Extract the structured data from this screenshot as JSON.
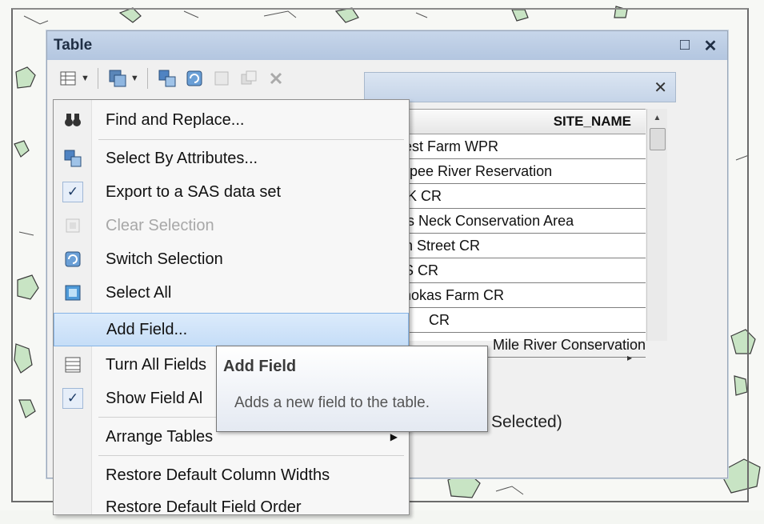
{
  "window": {
    "title": "Table"
  },
  "title_controls": {
    "restore": "□",
    "close": "✕"
  },
  "tab": {
    "close": "✕"
  },
  "table": {
    "column_header": "SITE_NAME",
    "rows": [
      "Hycrest Farm WPR",
      "Mashpee River Reservation",
      "COOK CR",
      "Wings Neck Conservation Area",
      "Heath Street CR",
      "HAAS CR",
      "Stelmokas Farm CR",
      "CR",
      "Mile River Conservation A"
    ]
  },
  "status": {
    "text": "Selected)"
  },
  "context_menu": {
    "items": [
      {
        "label": "Find and Replace...",
        "icon": "binoculars-icon"
      },
      {
        "label": "Select By Attributes...",
        "icon": "select-by-attributes-icon"
      },
      {
        "label": "Export to a SAS data set",
        "icon": "checkmark-icon"
      },
      {
        "label": "Clear Selection",
        "icon": "clear-selection-icon"
      },
      {
        "label": "Switch Selection",
        "icon": "switch-selection-icon"
      },
      {
        "label": "Select All",
        "icon": "select-all-icon"
      },
      {
        "label": "Add Field...",
        "icon": ""
      },
      {
        "label": "Turn All Fields",
        "icon": "field-list-icon"
      },
      {
        "label": "Show Field Al",
        "icon": "checkmark-icon"
      },
      {
        "label": "Arrange Tables",
        "icon": ""
      },
      {
        "label": "Restore Default Column Widths",
        "icon": ""
      },
      {
        "label": "Restore Default Field Order",
        "icon": ""
      }
    ],
    "check_glyph": "✓",
    "submenu_glyph": "▶"
  },
  "tooltip": {
    "title": "Add Field",
    "description": "Adds a new field to the table."
  }
}
